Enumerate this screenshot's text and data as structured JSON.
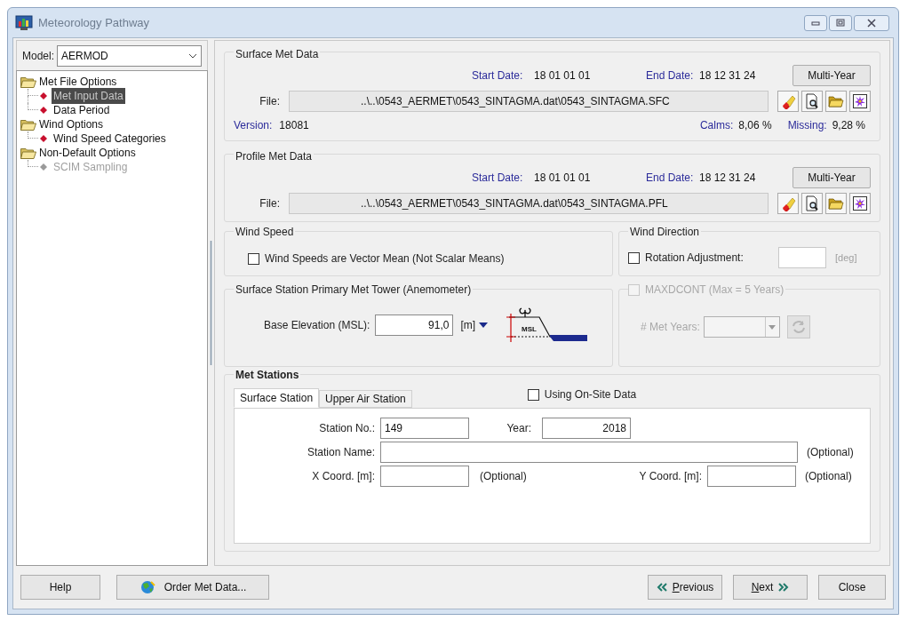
{
  "window": {
    "title": "Meteorology Pathway"
  },
  "model": {
    "label": "Model:",
    "value": "AERMOD"
  },
  "tree": [
    {
      "label": "Met File Options",
      "children": [
        {
          "label": "Met Input Data",
          "selected": true,
          "disabled": false
        },
        {
          "label": "Data Period",
          "selected": false,
          "disabled": false
        }
      ]
    },
    {
      "label": "Wind Options",
      "children": [
        {
          "label": "Wind Speed Categories",
          "selected": false,
          "disabled": false
        }
      ]
    },
    {
      "label": "Non-Default Options",
      "children": [
        {
          "label": "SCIM Sampling",
          "selected": false,
          "disabled": true
        }
      ]
    }
  ],
  "met_sections": [
    {
      "title": "Surface Met Data",
      "start_date_label": "Start Date:",
      "start_date": "18 01 01 01",
      "end_date_label": "End Date:",
      "end_date": "18 12 31 24",
      "multi_year_button": "Multi-Year",
      "file_label": "File:",
      "file_path": "..\\..\\0543_AERMET\\0543_SINTAGMA.dat\\0543_SINTAGMA.SFC",
      "version_label": "Version:",
      "version": "18081",
      "calms_label": "Calms:",
      "calms": "8,06 %",
      "missing_label": "Missing:",
      "missing": "9,28 %"
    },
    {
      "title": "Profile Met Data",
      "start_date_label": "Start Date:",
      "start_date": "18 01 01 01",
      "end_date_label": "End Date:",
      "end_date": "18 12 31 24",
      "multi_year_button": "Multi-Year",
      "file_label": "File:",
      "file_path": "..\\..\\0543_AERMET\\0543_SINTAGMA.dat\\0543_SINTAGMA.PFL"
    }
  ],
  "wind_speed": {
    "title": "Wind Speed",
    "checkbox": {
      "label": "Wind Speeds are Vector Mean (Not Scalar Means)",
      "checked": false
    }
  },
  "wind_direction": {
    "title": "Wind Direction",
    "checkbox": {
      "label": "Rotation Adjustment:",
      "checked": false
    },
    "unit": "[deg]"
  },
  "met_tower": {
    "title": "Surface Station Primary Met Tower (Anemometer)",
    "base_elevation_label": "Base Elevation (MSL):",
    "base_elevation": "91,0",
    "unit": "[m]",
    "diagram_label": "MSL"
  },
  "maxdcont": {
    "label": "MAXDCONT (Max = 5 Years)",
    "checked": false,
    "disabled": true,
    "met_years_label": "# Met Years:"
  },
  "met_stations": {
    "title": "Met Stations",
    "tabs": [
      {
        "label": "Surface Station",
        "selected": true
      },
      {
        "label": "Upper Air Station",
        "selected": false
      }
    ],
    "on_site": {
      "label": "Using On-Site Data",
      "checked": false
    },
    "station_no_label": "Station No.:",
    "station_no": "149",
    "year_label": "Year:",
    "year": "2018",
    "station_name_label": "Station Name:",
    "station_name_note": "(Optional)",
    "x_coord_label": "X Coord. [m]:",
    "x_coord_note": "(Optional)",
    "y_coord_label": "Y Coord. [m]:",
    "y_coord_note": "(Optional)"
  },
  "buttons": {
    "help": "Help",
    "order": "Order Met Data...",
    "previous": "Previous",
    "next": "Next",
    "close": "Close"
  }
}
